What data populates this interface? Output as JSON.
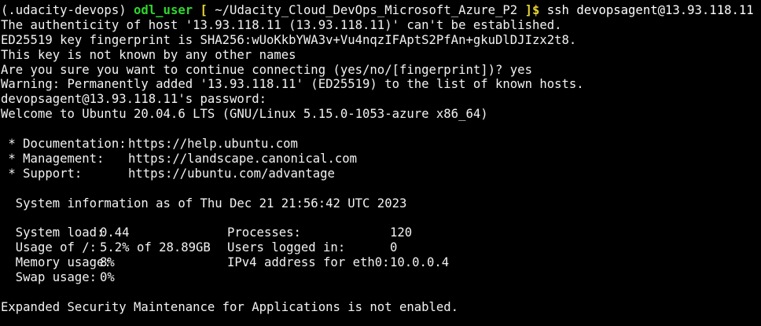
{
  "colors": {
    "background": "#000000",
    "text": "#f2f2f2",
    "prompt_user": "#2fd52f",
    "prompt_path": "#e6d335"
  },
  "prompt": {
    "env": "(.udacity-devops)",
    "user": "odl_user",
    "bracket_open": "[",
    "path": "~/Udacity_Cloud_DevOps_Microsoft_Azure_P2",
    "bracket_close": "]$",
    "command": "ssh devopsagent@13.93.118.11"
  },
  "output": {
    "line1": "The authenticity of host '13.93.118.11 (13.93.118.11)' can't be established.",
    "line2": "ED25519 key fingerprint is SHA256:wUoKkbYWA3v+Vu4nqzIFAptS2PfAn+gkuDlDJIzx2t8.",
    "line3": "This key is not known by any other names",
    "line4": "Are you sure you want to continue connecting (yes/no/[fingerprint])? yes",
    "line5": "Warning: Permanently added '13.93.118.11' (ED25519) to the list of known hosts.",
    "line6": "devopsagent@13.93.118.11's password:",
    "line7": "Welcome to Ubuntu 20.04.6 LTS (GNU/Linux 5.15.0-1053-azure x86_64)"
  },
  "links": [
    {
      "label": " * Documentation:",
      "url": "https://help.ubuntu.com"
    },
    {
      "label": " * Management:",
      "url": "https://landscape.canonical.com"
    },
    {
      "label": " * Support:",
      "url": "https://ubuntu.com/advantage"
    }
  ],
  "sysinfo": {
    "header": "  System information as of Thu Dec 21 21:56:42 UTC 2023",
    "rows": [
      {
        "l_label": "  System load:",
        "l_value": "0.44",
        "r_label": "Processes:",
        "r_value": "120"
      },
      {
        "l_label": "  Usage of /:",
        "l_value": "5.2% of 28.89GB",
        "r_label": "Users logged in:",
        "r_value": "0"
      },
      {
        "l_label": "  Memory usage:",
        "l_value": "8%",
        "r_label": "IPv4 address for eth0:",
        "r_value": "10.0.0.4"
      },
      {
        "l_label": "  Swap usage:",
        "l_value": "0%",
        "r_label": "",
        "r_value": ""
      }
    ]
  },
  "footer": "Expanded Security Maintenance for Applications is not enabled."
}
